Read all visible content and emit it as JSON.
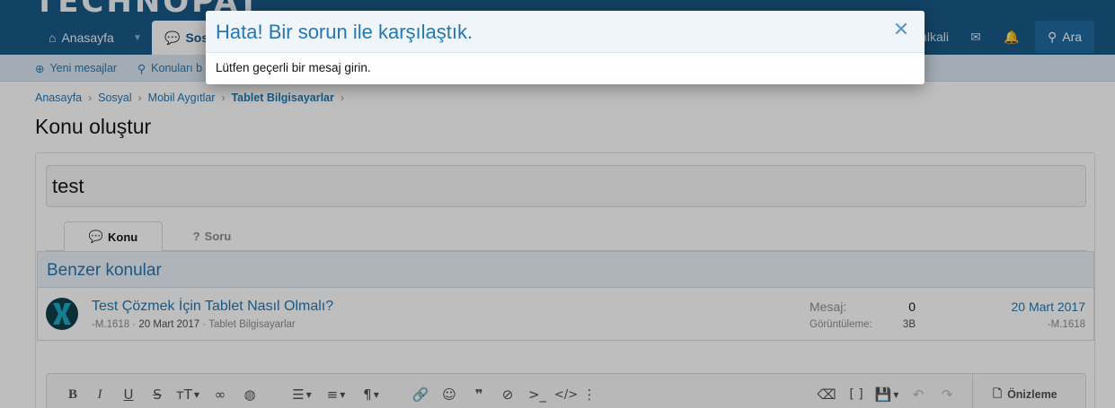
{
  "site": {
    "logo_text": "TECHNOPAT"
  },
  "header": {
    "nav": {
      "home_label": "Anasayfa",
      "social_label": "Sos"
    },
    "right": {
      "user_label": "ılkali",
      "search_label": "Ara"
    }
  },
  "subnav": {
    "new_messages": "Yeni mesajlar",
    "search_topics": "Konuları b"
  },
  "breadcrumb": [
    "Anasayfa",
    "Sosyal",
    "Mobil Aygıtlar",
    "Tablet Bilgisayarlar"
  ],
  "page_title": "Konu oluştur",
  "form": {
    "title_value": "test",
    "tabs": [
      {
        "label": "Konu"
      },
      {
        "label": "Soru"
      }
    ]
  },
  "similar": {
    "heading": "Benzer konular",
    "item": {
      "title": "Test Çözmek İçin Tablet Nasıl Olmalı?",
      "author": "-M.1618",
      "date": "20 Mart 2017",
      "forum": "Tablet Bilgisayarlar",
      "replies_label": "Mesaj:",
      "replies_value": "0",
      "views_label": "Görüntüleme:",
      "views_value": "3B",
      "last_date": "20 Mart 2017",
      "last_author": "-M.1618"
    }
  },
  "editor": {
    "preview_label": "Önizleme"
  },
  "modal": {
    "title": "Hata! Bir sorun ile karşılaştık.",
    "message": "Lütfen geçerli bir mesaj girin.",
    "close_symbol": "✕"
  }
}
